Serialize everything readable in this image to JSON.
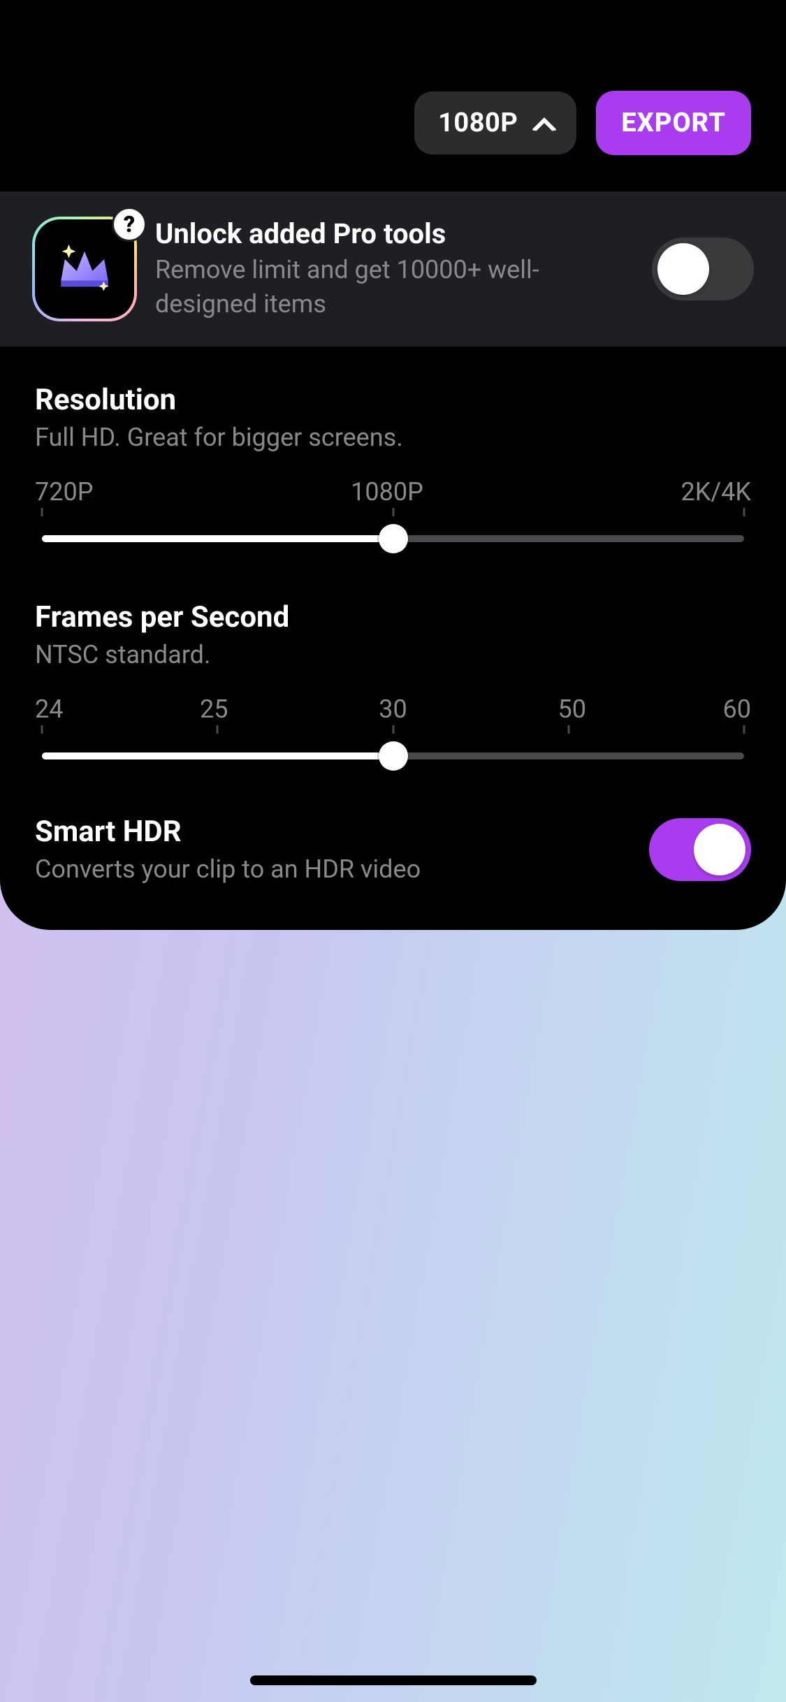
{
  "header": {
    "resolution_chip": "1080P",
    "export_label": "EXPORT"
  },
  "pro_banner": {
    "title": "Unlock added Pro tools",
    "subtitle": "Remove limit and get 10000+ well-designed items",
    "help_glyph": "?",
    "enabled": false
  },
  "resolution": {
    "title": "Resolution",
    "subtitle": "Full HD. Great for bigger screens.",
    "labels": [
      "720P",
      "1080P",
      "2K/4K"
    ],
    "value_index": 1,
    "value_percent": 50
  },
  "fps": {
    "title": "Frames per Second",
    "subtitle": "NTSC standard.",
    "labels": [
      "24",
      "25",
      "30",
      "50",
      "60"
    ],
    "value_index": 2,
    "value_percent": 50
  },
  "hdr": {
    "title": "Smart HDR",
    "subtitle": "Converts your clip to an HDR video",
    "enabled": true
  },
  "colors": {
    "accent": "#aa3cf0",
    "chip_bg": "#2c2c2e",
    "secondary_text": "#8a8a8d"
  }
}
